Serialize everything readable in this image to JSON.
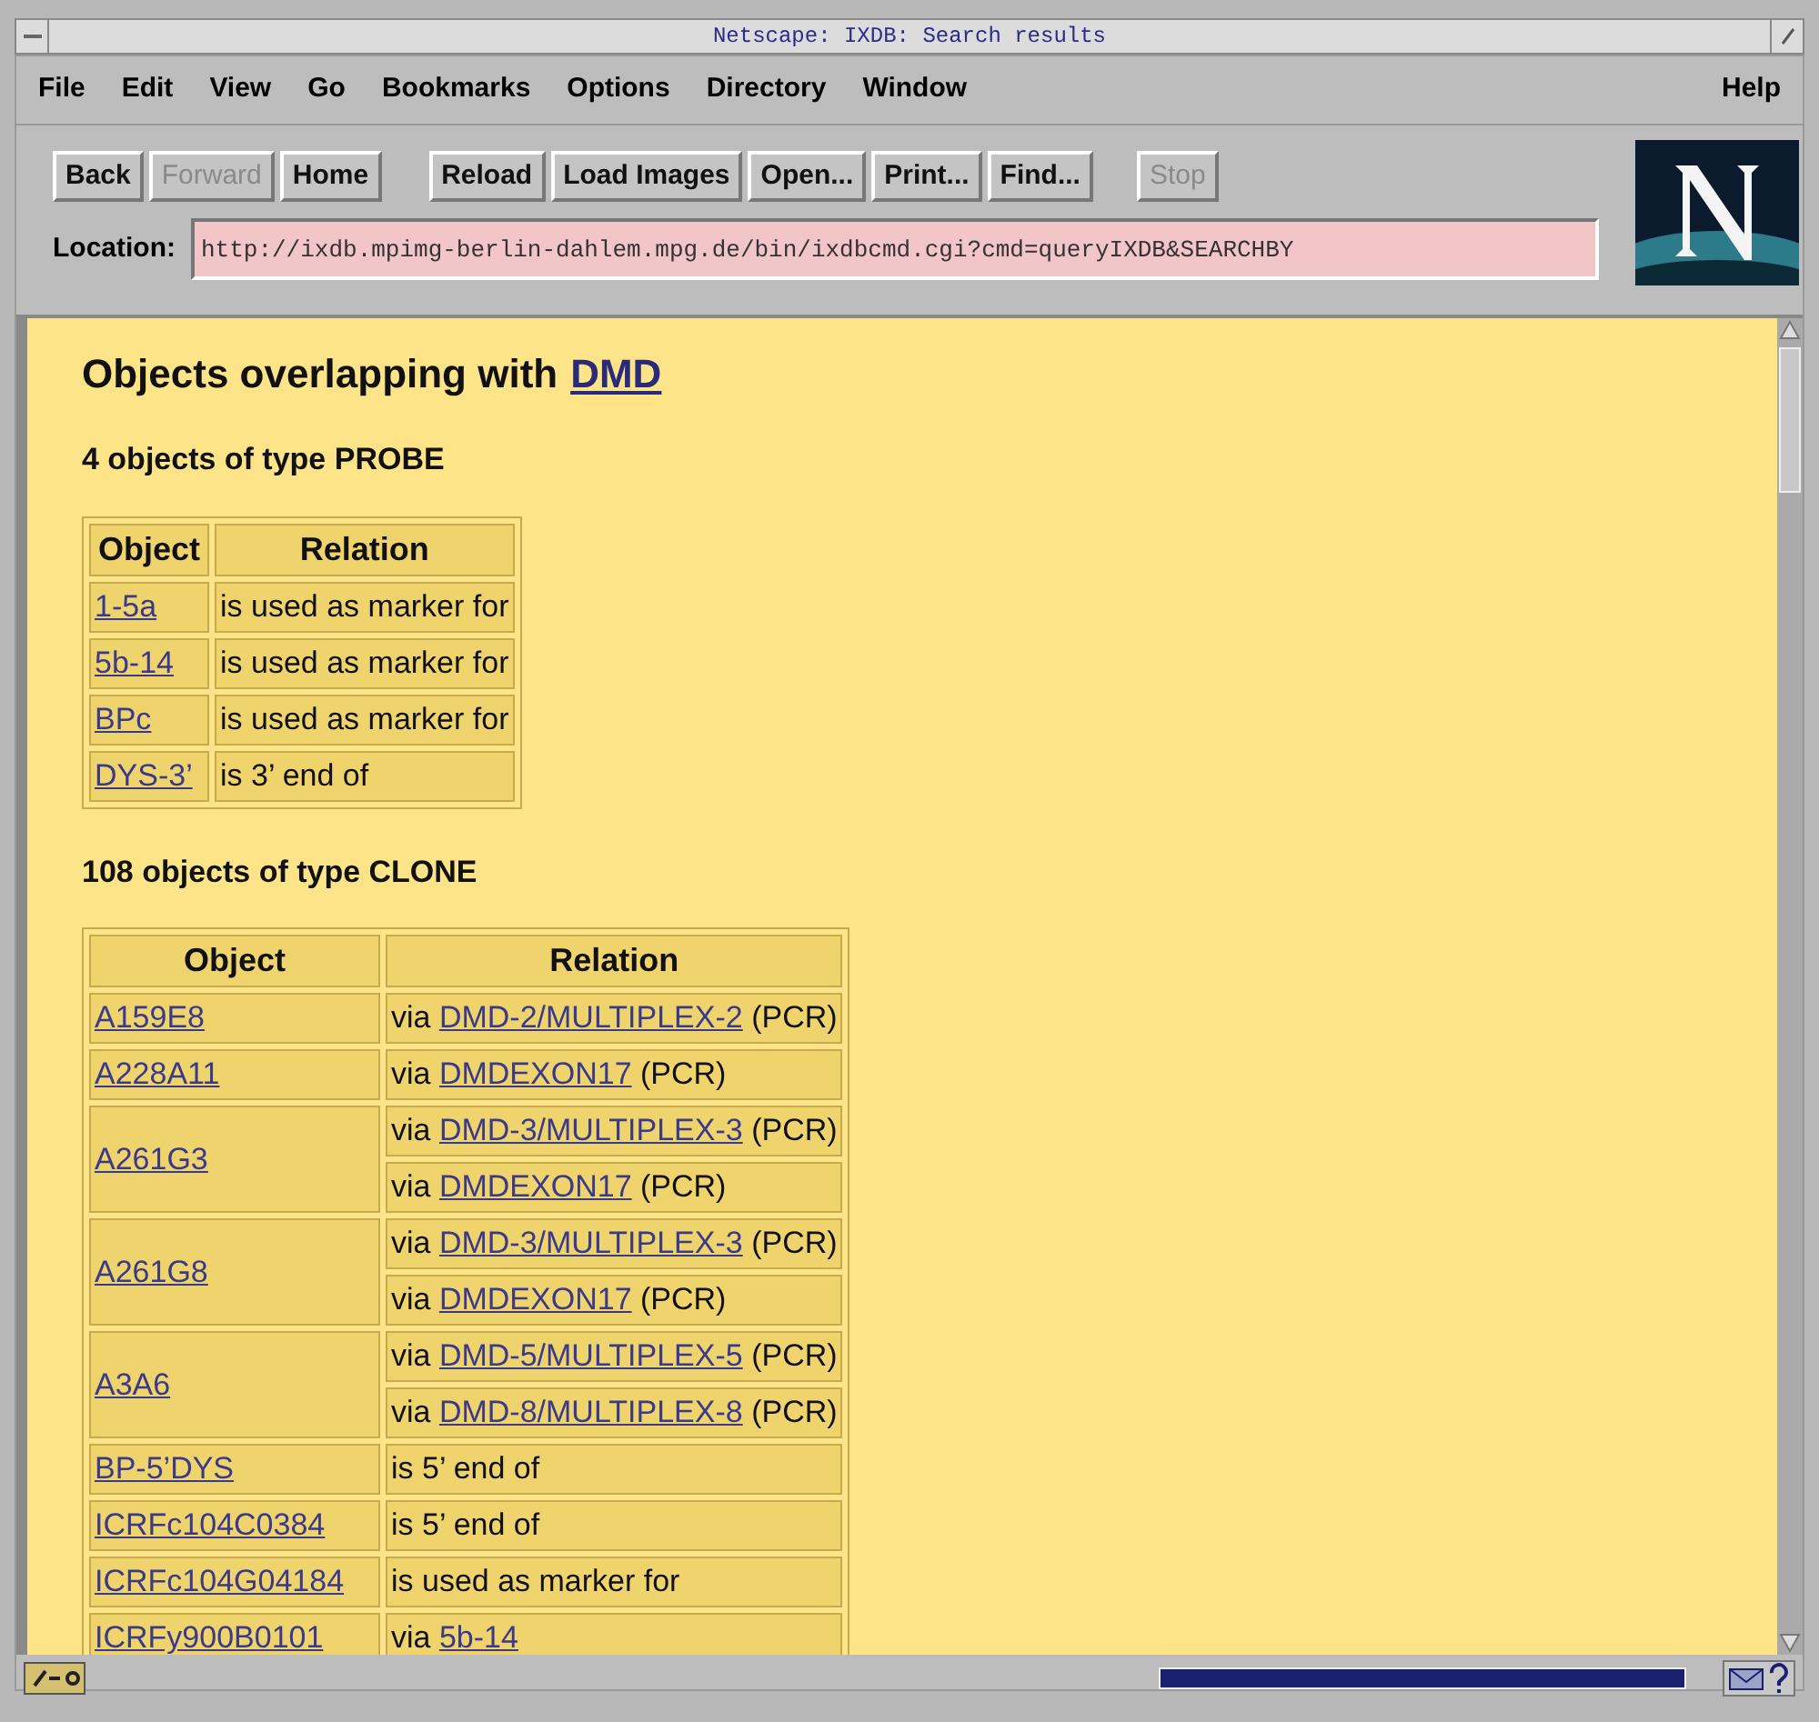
{
  "window": {
    "title": "Netscape: IXDB: Search results"
  },
  "menu": [
    {
      "label": "File"
    },
    {
      "label": "Edit"
    },
    {
      "label": "View"
    },
    {
      "label": "Go"
    },
    {
      "label": "Bookmarks"
    },
    {
      "label": "Options"
    },
    {
      "label": "Directory"
    },
    {
      "label": "Window"
    },
    {
      "label": "Help"
    }
  ],
  "toolbar": [
    {
      "label": "Back",
      "disabled": false
    },
    {
      "label": "Forward",
      "disabled": true
    },
    {
      "label": "Home",
      "disabled": false
    },
    {
      "label": "Reload",
      "disabled": false
    },
    {
      "label": "Load Images",
      "disabled": false
    },
    {
      "label": "Open...",
      "disabled": false
    },
    {
      "label": "Print...",
      "disabled": false
    },
    {
      "label": "Find...",
      "disabled": false
    },
    {
      "label": "Stop",
      "disabled": true
    }
  ],
  "location": {
    "label": "Location:",
    "value": "http://ixdb.mpimg-berlin-dahlem.mpg.de/bin/ixdbcmd.cgi?cmd=queryIXDB&SEARCHBY"
  },
  "page": {
    "heading": "Objects overlapping with",
    "heading_link": "DMD",
    "sections": [
      {
        "title": "4 objects of type PROBE",
        "columns": [
          "Object",
          "Relation"
        ],
        "rows": [
          {
            "object": "1-5a",
            "relations": [
              {
                "text": "is used as marker for"
              }
            ]
          },
          {
            "object": "5b-14",
            "relations": [
              {
                "text": "is used as marker for"
              }
            ]
          },
          {
            "object": "BPc",
            "relations": [
              {
                "text": "is used as marker for"
              }
            ]
          },
          {
            "object": "DYS-3’",
            "relations": [
              {
                "text": "is 3’ end of"
              }
            ]
          }
        ]
      },
      {
        "title": "108 objects of type CLONE",
        "columns": [
          "Object",
          "Relation"
        ],
        "rows": [
          {
            "object": "A159E8",
            "relations": [
              {
                "text": "via",
                "link": "DMD-2/MULTIPLEX-2",
                "suffix": "(PCR)"
              }
            ]
          },
          {
            "object": "A228A11",
            "relations": [
              {
                "text": "via",
                "link": "DMDEXON17",
                "suffix": "(PCR)"
              }
            ]
          },
          {
            "object": "A261G3",
            "relations": [
              {
                "text": "via",
                "link": "DMD-3/MULTIPLEX-3",
                "suffix": "(PCR)"
              },
              {
                "text": "via",
                "link": "DMDEXON17",
                "suffix": "(PCR)"
              }
            ]
          },
          {
            "object": "A261G8",
            "relations": [
              {
                "text": "via",
                "link": "DMD-3/MULTIPLEX-3",
                "suffix": "(PCR)"
              },
              {
                "text": "via",
                "link": "DMDEXON17",
                "suffix": "(PCR)"
              }
            ]
          },
          {
            "object": "A3A6",
            "relations": [
              {
                "text": "via",
                "link": "DMD-5/MULTIPLEX-5",
                "suffix": "(PCR)"
              },
              {
                "text": "via",
                "link": "DMD-8/MULTIPLEX-8",
                "suffix": "(PCR)"
              }
            ]
          },
          {
            "object": "BP-5’DYS",
            "relations": [
              {
                "text": "is 5’ end of"
              }
            ]
          },
          {
            "object": "ICRFc104C0384",
            "relations": [
              {
                "text": "is 5’ end of"
              }
            ]
          },
          {
            "object": "ICRFc104G04184",
            "relations": [
              {
                "text": "is used as marker for"
              }
            ]
          },
          {
            "object": "ICRFy900B0101",
            "relations": [
              {
                "text": "via",
                "link": "5b-14"
              }
            ]
          }
        ]
      }
    ]
  },
  "status_bar": {
    "progress": {
      "level": 1
    }
  }
}
